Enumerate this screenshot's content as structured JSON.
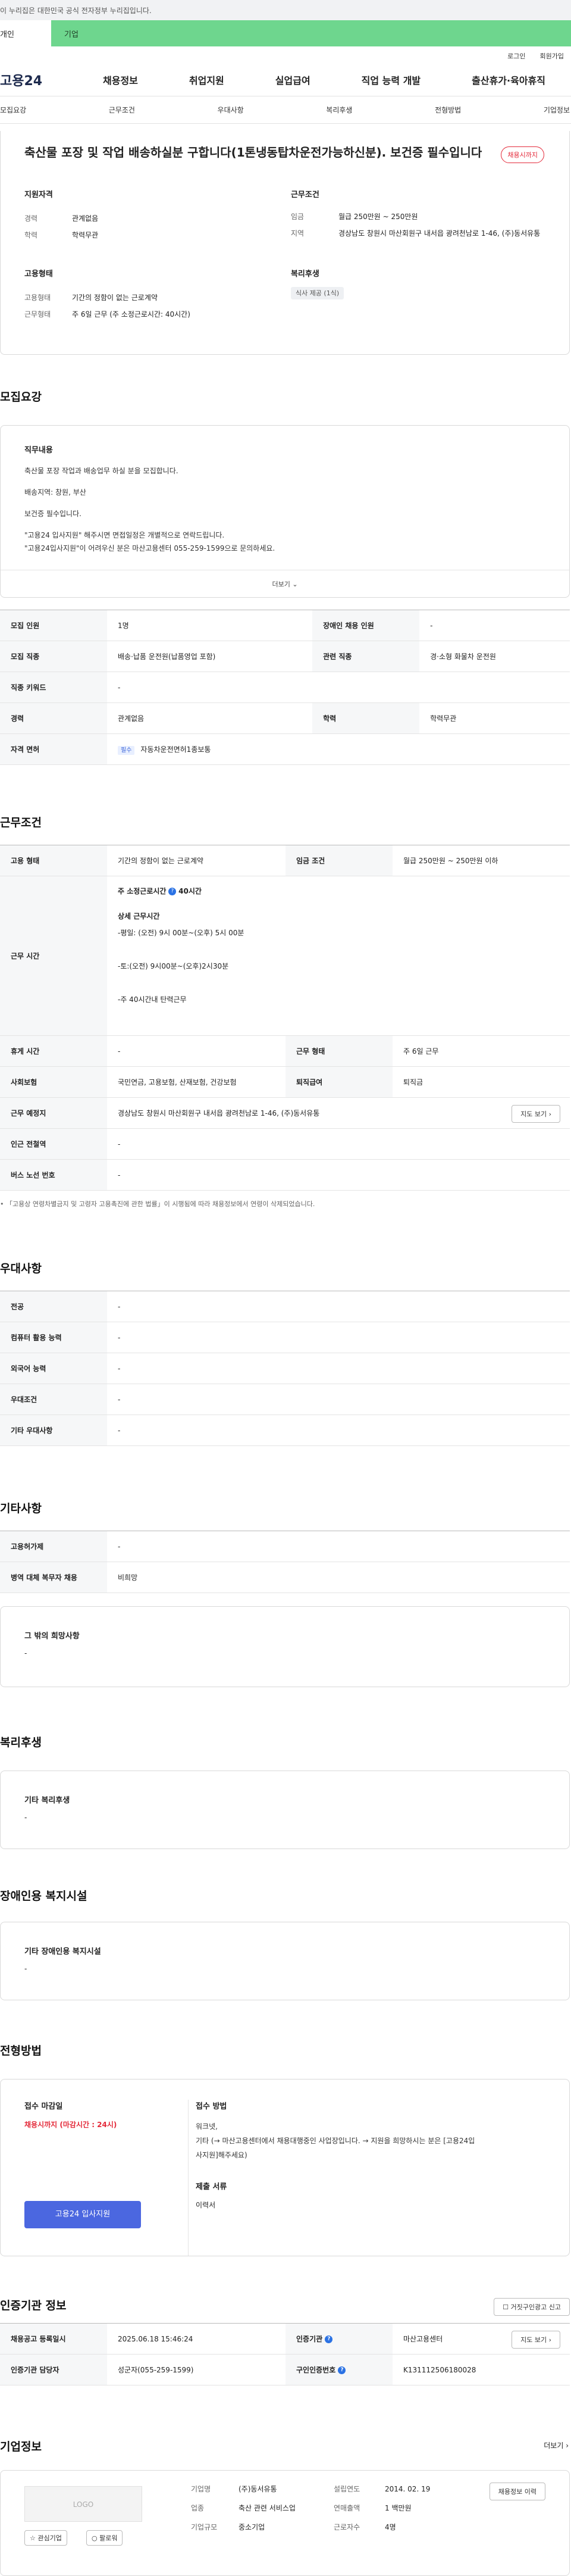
{
  "gov_banner": "이 누리집은 대한민국 공식 전자정부 누리집입니다.",
  "user_tabs": {
    "personal": "개인",
    "company": "기업"
  },
  "util": {
    "login": "로그인",
    "signup": "회원가입"
  },
  "logo": "고용24",
  "gnb": [
    "채용정보",
    "취업지원",
    "실업급여",
    "직업 능력 개발",
    "출산휴가·육아휴직"
  ],
  "subnav": [
    "모집요강",
    "근무조건",
    "우대사항",
    "복리후생",
    "전형방법",
    "기업정보"
  ],
  "job": {
    "title": "축산물 포장 및 작업 배송하실분 구합니다(1톤냉동탑차운전가능하신분). 보건증 필수입니다",
    "badge": "채용시까지",
    "qual_title": "지원자격",
    "qual": [
      {
        "k": "경력",
        "v": "관계없음"
      },
      {
        "k": "학력",
        "v": "학력무관"
      }
    ],
    "cond_title": "근무조건",
    "cond": [
      {
        "k": "임금",
        "v": "월급 250만원 ~ 250만원"
      },
      {
        "k": "지역",
        "v": "경상남도 창원시 마산회원구 내서읍 광려천남로 1-46, (주)동서유통"
      }
    ],
    "emp_title": "고용형태",
    "emp": [
      {
        "k": "고용형태",
        "v": "기간의 정함이 없는 근로계약"
      },
      {
        "k": "근무형태",
        "v": "주 6일 근무 (주 소정근로시간: 40시간)"
      }
    ],
    "welfare_title": "복리후생",
    "welfare_tag": "식사 제공 (1식)"
  },
  "recruit": {
    "title": "모집요강",
    "desc_title": "직무내용",
    "desc": [
      "축산물 포장 작업과 배송업무 하실 분을 모집합니다.",
      "배송지역: 창원, 부산",
      "보건증 필수입니다.",
      "\"고용24 입사지원\" 해주시면 면접일정은 개별적으로 연락드립니다.",
      "\"고용24입사지원\"이 어려우신 분은 마산고용센터 055-259-1599으로 문의하세요."
    ],
    "more": "더보기",
    "rows": [
      {
        "a": "모집 인원",
        "b": "1명",
        "c": "장애인 채용 인원",
        "d": "-"
      },
      {
        "a": "모집 직종",
        "b": "배송·납품 운전원(납품영업 포함)",
        "c": "관련 직종",
        "d": "경·소형 화물차 운전원"
      },
      {
        "a": "직종 키워드",
        "b": "-"
      },
      {
        "a": "경력",
        "b": "관계없음",
        "c": "학력",
        "d": "학력무관"
      }
    ],
    "license_label": "자격 면허",
    "license_tag": "필수",
    "license_value": "자동차운전면허1종보통"
  },
  "work": {
    "title": "근무조건",
    "emp_label": "고용 형태",
    "emp_value": "기간의 정함이 없는 근로계약",
    "wage_label": "임금 조건",
    "wage_value": "월급 250만원 ~ 250만원 이하",
    "hours_label": "근무 시간",
    "hours_week": "주 소정근로시간",
    "hours_week_val": "40시간",
    "hours_detail_title": "상세 근무시간",
    "hours_detail": [
      "-평일: (오전) 9시 00분~(오후) 5시 00분",
      "",
      "-토:(오전) 9시00분~(오후)2시30분",
      "",
      "-주 40시간내 탄력근무"
    ],
    "rest_label": "휴게 시간",
    "rest_value": "-",
    "type_label": "근무 형태",
    "type_value": "주 6일 근무",
    "insurance_label": "사회보험",
    "insurance_value": "국민연금, 고용보험, 산재보험, 건강보험",
    "retire_label": "퇴직급여",
    "retire_value": "퇴직금",
    "place_label": "근무 예정지",
    "place_value": "경상남도 창원시 마산회원구 내서읍 광려천남로 1-46, (주)동서유통",
    "map_btn": "지도 보기",
    "subway_label": "인근 전철역",
    "subway_value": "-",
    "bus_label": "버스 노선 번호",
    "bus_value": "-",
    "note": "「고용상 연령차별금지 및 고령자 고용촉진에 관한 법률」이 시행됨에 따라 채용정보에서 연령이 삭제되었습니다."
  },
  "pref": {
    "title": "우대사항",
    "rows": [
      {
        "k": "전공",
        "v": "-"
      },
      {
        "k": "컴퓨터 활용 능력",
        "v": "-"
      },
      {
        "k": "외국어 능력",
        "v": "-"
      },
      {
        "k": "우대조건",
        "v": "-"
      },
      {
        "k": "기타 우대사항",
        "v": "-"
      }
    ]
  },
  "etc": {
    "title": "기타사항",
    "rows": [
      {
        "k": "고용허가제",
        "v": "-"
      },
      {
        "k": "병역 대체 복무자 채용",
        "v": "비희망"
      }
    ],
    "box_title": "그 밖의 희망사항",
    "box_value": "-"
  },
  "benefit": {
    "title": "복리후생",
    "box_title": "기타 복리후생",
    "box_value": "-"
  },
  "disabled": {
    "title": "장애인용 복지시설",
    "box_title": "기타 장애인용 복지시설",
    "box_value": "-"
  },
  "process": {
    "title": "전형방법",
    "deadline_title": "접수 마감일",
    "deadline_value": "채용시까지 (마감시간 : 24시)",
    "apply_btn": "고용24 입사지원",
    "method_title": "접수 방법",
    "method_lines": [
      "워크넷,",
      "기타 (→ 마산고용센터에서 채용대행중인 사업장입니다. → 지원을 희망하시는 분은 [고용24입",
      "사지원]해주세요)"
    ],
    "docs_title": "제출 서류",
    "docs_value": "이력서"
  },
  "agency": {
    "title": "인증기관 정보",
    "report_btn": "거짓구인광고 신고",
    "reg_label": "채용공고 등록일시",
    "reg_value": "2025.06.18 15:46:24",
    "inst_label": "인증기관",
    "inst_value": "마산고용센터",
    "map_btn": "지도 보기",
    "mgr_label": "인증기관 담당자",
    "mgr_value": "성군자(055-259-1599)",
    "id_label": "구인인증번호",
    "id_value": "K131112506180028"
  },
  "company": {
    "title": "기업정보",
    "more": "더보기",
    "logo": "LOGO",
    "fav_btn": "관심기업",
    "follow_btn": "팔로워",
    "name_label": "기업명",
    "name_value": "(주)동서유통",
    "ind_label": "업종",
    "ind_value": "축산 관련 서비스업",
    "size_label": "기업규모",
    "size_value": "중소기업",
    "est_label": "설립연도",
    "est_value": "2014. 02. 19",
    "sales_label": "연매출액",
    "sales_value": "1 백만원",
    "emp_label": "근로자수",
    "emp_value": "4명",
    "history_btn": "채용정보 이력"
  }
}
